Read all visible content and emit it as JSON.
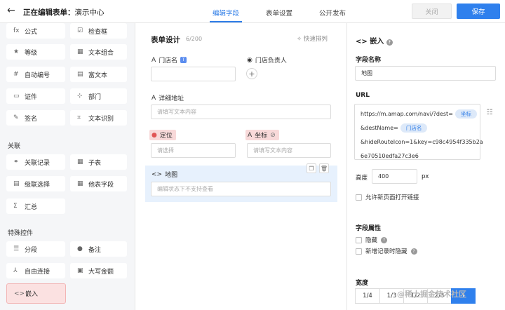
{
  "header": {
    "back_icon": "arrow-left-icon",
    "editing_label": "正在编辑表单：",
    "app_name": "演示中心",
    "tabs": [
      {
        "label": "编辑字段"
      },
      {
        "label": "表单设置"
      },
      {
        "label": "公开发布"
      }
    ],
    "close_label": "关闭",
    "save_label": "保存"
  },
  "components": {
    "basic": [
      {
        "icon": "fx",
        "label": "公式"
      },
      {
        "icon": "☑",
        "label": "检查框"
      },
      {
        "icon": "★",
        "label": "等级"
      },
      {
        "icon": "▦",
        "label": "文本组合"
      },
      {
        "icon": "#",
        "label": "自动编号"
      },
      {
        "icon": "▤",
        "label": "富文本"
      },
      {
        "icon": "▭",
        "label": "证件"
      },
      {
        "icon": "⊹",
        "label": "部门"
      },
      {
        "icon": "✎",
        "label": "签名"
      },
      {
        "icon": "⌗",
        "label": "文本识别"
      }
    ],
    "relation_title": "关联",
    "relation": [
      {
        "icon": "⚭",
        "label": "关联记录"
      },
      {
        "icon": "▦",
        "label": "子表"
      },
      {
        "icon": "▤",
        "label": "级联选择"
      },
      {
        "icon": "▦",
        "label": "他表字段"
      },
      {
        "icon": "Σ",
        "label": "汇总"
      }
    ],
    "special_title": "特殊控件",
    "special": [
      {
        "icon": "☰",
        "label": "分段"
      },
      {
        "icon": "●",
        "label": "备注"
      },
      {
        "icon": "⅄",
        "label": "自由连接"
      },
      {
        "icon": "▣",
        "label": "大写金额"
      },
      {
        "icon": "<>",
        "label": "嵌入"
      }
    ]
  },
  "canvas": {
    "title": "表单设计",
    "count": "6/200",
    "quick_sort": "快速排列",
    "fields": {
      "store_name": {
        "label": "门店名",
        "badge": "T"
      },
      "store_manager": {
        "label": "门店负责人"
      },
      "address": {
        "label": "详细地址",
        "placeholder": "请填写文本内容"
      },
      "location": {
        "label": "定位",
        "placeholder": "请选择"
      },
      "coordinates": {
        "label": "坐标",
        "placeholder": "请填写文本内容"
      },
      "map": {
        "label": "地图",
        "placeholder": "编辑状态下不支持查看"
      }
    }
  },
  "props": {
    "title": "嵌入",
    "field_name_label": "字段名称",
    "field_name_value": "地图",
    "url_label": "URL",
    "url_lines": {
      "l1": "https://m.amap.com/navi/?dest=",
      "p1": "坐标",
      "l2": "&destName=",
      "p2": "门店名",
      "l3": "&hideRouteIcon=1&key=c98c4954f335b2a",
      "l4": "6e70510edfa27c3e6"
    },
    "height_label": "高度",
    "height_value": "400",
    "height_unit": "px",
    "open_new_page": "允许新页面打开链接",
    "attr_title": "字段属性",
    "hidden": "隐藏",
    "hide_on_new": "新增记录时隐藏",
    "width_title": "宽度",
    "width_options": [
      "1/4",
      "1/3",
      "1/2",
      "2/3",
      "1"
    ]
  },
  "watermark": "@稀土掘金技术社区"
}
